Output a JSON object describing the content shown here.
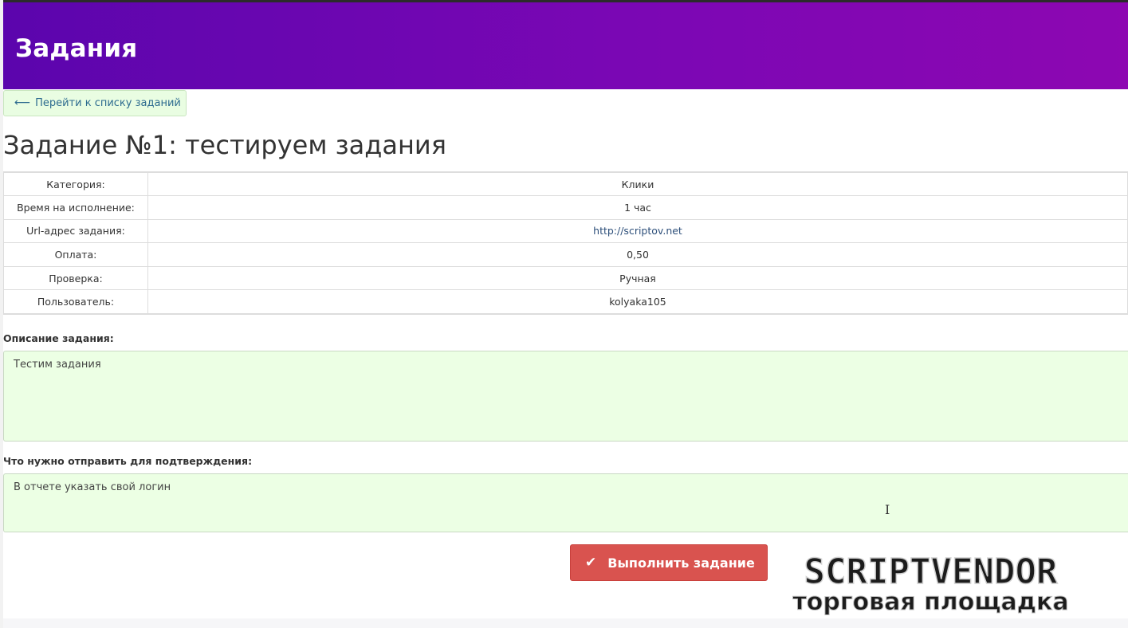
{
  "header": {
    "title": "Задания"
  },
  "back_button": {
    "arrow": "⟵",
    "label": "Перейти к списку заданий"
  },
  "task": {
    "title": "Задание №1: тестируем задания"
  },
  "details": [
    {
      "label": "Категория:",
      "value": "Клики"
    },
    {
      "label": "Время на исполнение:",
      "value": "1 час"
    },
    {
      "label": "Url-адрес задания:",
      "value": "http://scriptov.net"
    },
    {
      "label": "Оплата:",
      "value": "0,50"
    },
    {
      "label": "Проверка:",
      "value": "Ручная"
    },
    {
      "label": "Пользователь:",
      "value": "kolyaka105"
    }
  ],
  "description": {
    "label": "Описание задания:",
    "text": "Тестим задания"
  },
  "confirmation": {
    "label": "Что нужно отправить для подтверждения:",
    "text": "В отчете указать свой логин"
  },
  "submit_button": {
    "label": "Выполнить задание"
  },
  "watermark": {
    "main": "SCRIPTVENDOR",
    "sub": "торговая площадка"
  },
  "icons": {
    "back": "arrow-left-icon",
    "submit": "check-icon",
    "cursor": "text-cursor-icon"
  },
  "colors": {
    "header_gradient_start": "#5b05ad",
    "header_gradient_end": "#8d07b2",
    "back_button_bg": "#e9fde2",
    "textbox_bg": "#ecffe4",
    "submit_bg": "#d9534f"
  }
}
